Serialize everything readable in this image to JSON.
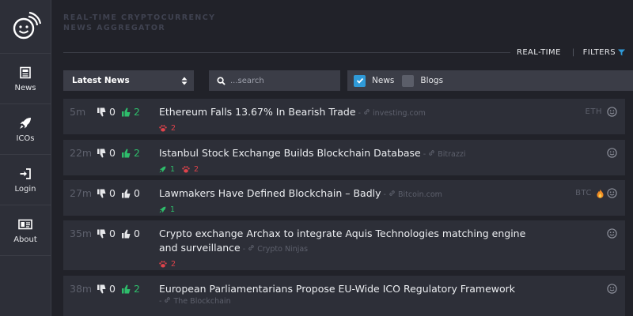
{
  "app": {
    "title_line1": "REAL-TIME CRYPTOCURRENCY",
    "title_line2": "NEWS AGGREGATOR",
    "logo_icon": "smiley-wifi-icon"
  },
  "sidebar": {
    "items": [
      {
        "label": "News",
        "icon": "newspaper-icon"
      },
      {
        "label": "ICOs",
        "icon": "rocket-icon"
      },
      {
        "label": "Login",
        "icon": "login-icon"
      },
      {
        "label": "About",
        "icon": "id-card-icon"
      }
    ]
  },
  "header_nav": {
    "realtime": "REAL-TIME",
    "separator": "|",
    "filters": "FILTERS"
  },
  "filter_bar": {
    "sort_value": "Latest News",
    "search_placeholder": "...search",
    "news_label": "News",
    "news_checked": true,
    "blogs_label": "Blogs",
    "blogs_checked": false
  },
  "colors": {
    "accent_blue": "#2f9ad8",
    "positive_green": "#2ebd6b",
    "negative_red": "#e0434b",
    "background": "#212229",
    "panel": "#2d2f38"
  },
  "news": [
    {
      "age": "5m",
      "dislikes": "0",
      "likes": "2",
      "liked": true,
      "title": "Ethereum Falls 13.67% In Bearish Trade",
      "source": "investing.com",
      "tags": [
        {
          "kind": "negative",
          "icon": "paw-icon",
          "count": "2"
        }
      ],
      "symbol": "ETH",
      "hot": false
    },
    {
      "age": "22m",
      "dislikes": "0",
      "likes": "2",
      "liked": true,
      "title": "Istanbul Stock Exchange Builds Blockchain Database",
      "source": "Bitrazzi",
      "tags": [
        {
          "kind": "positive",
          "icon": "rocket-icon",
          "count": "1"
        },
        {
          "kind": "negative",
          "icon": "paw-icon",
          "count": "2"
        }
      ],
      "symbol": "",
      "hot": false
    },
    {
      "age": "27m",
      "dislikes": "0",
      "likes": "0",
      "liked": false,
      "title": "Lawmakers Have Defined Blockchain – Badly",
      "source": "Bitcoin.com",
      "tags": [
        {
          "kind": "positive",
          "icon": "rocket-icon",
          "count": "1"
        }
      ],
      "symbol": "BTC",
      "hot": true
    },
    {
      "age": "35m",
      "dislikes": "0",
      "likes": "0",
      "liked": false,
      "title": "Crypto exchange Archax to integrate Aquis Technologies matching engine and surveillance",
      "source": "Crypto Ninjas",
      "tags": [
        {
          "kind": "negative",
          "icon": "paw-icon",
          "count": "2"
        }
      ],
      "symbol": "",
      "hot": false
    },
    {
      "age": "38m",
      "dislikes": "0",
      "likes": "2",
      "liked": true,
      "title": "European Parliamentarians Propose EU-Wide ICO Regulatory Framework",
      "source": "The Blockchain",
      "tags": [],
      "symbol": "",
      "hot": false
    }
  ]
}
